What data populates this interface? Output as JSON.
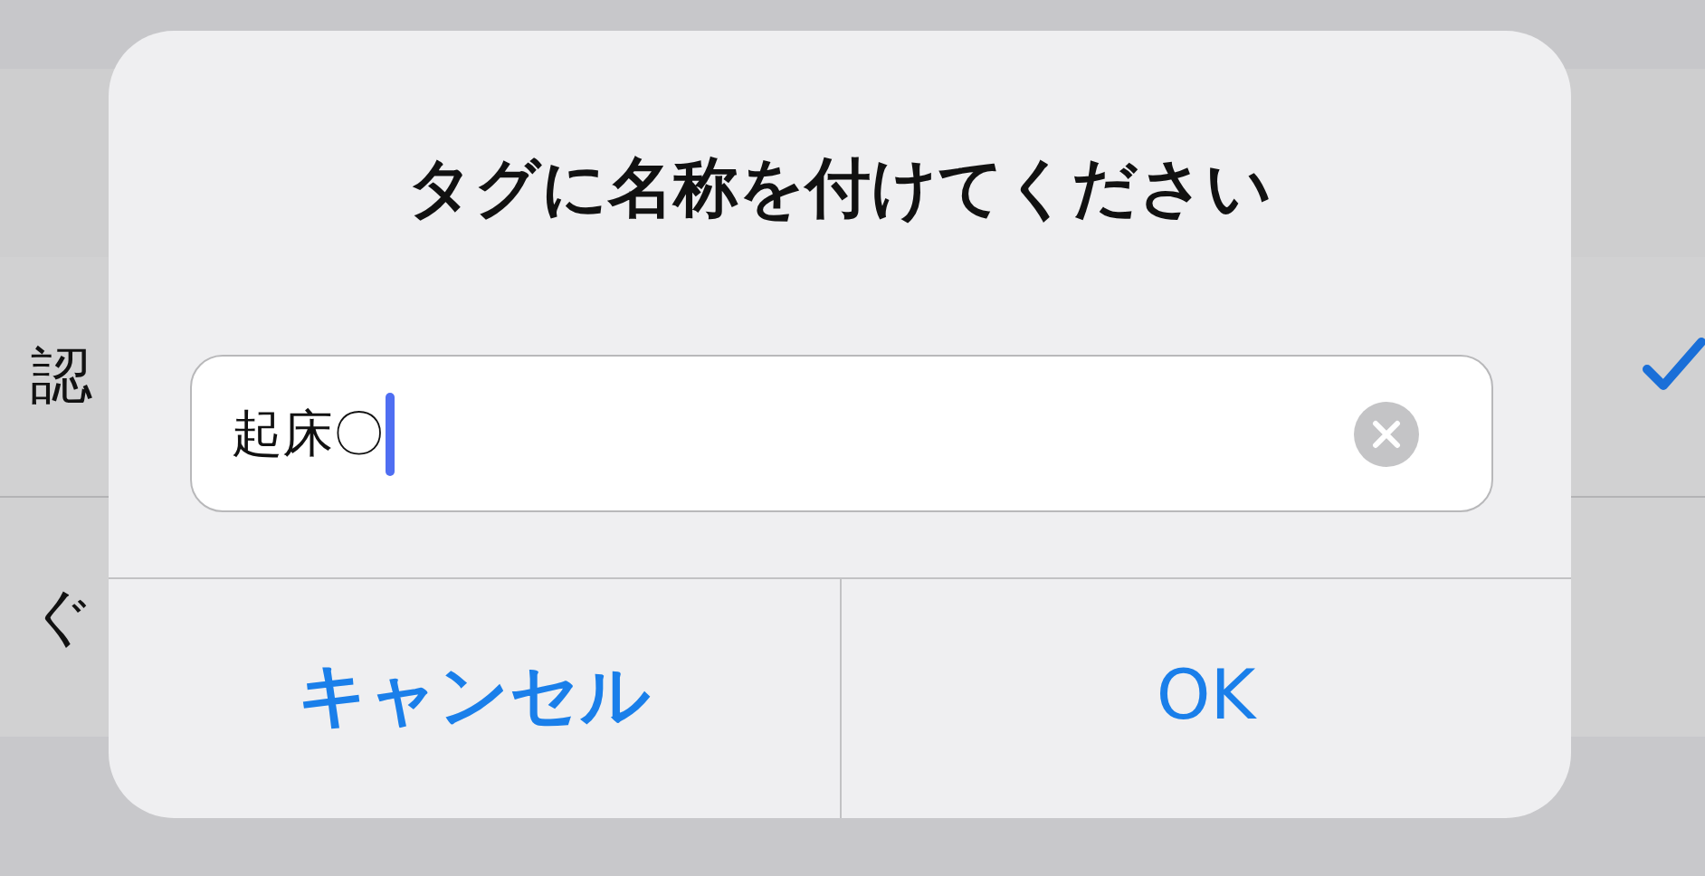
{
  "background_list": {
    "rows": [
      {
        "label": "認",
        "checked": true
      },
      {
        "label": "ぐ",
        "checked": false
      }
    ]
  },
  "dialog": {
    "title": "タグに名称を付けてください",
    "field": {
      "value": "起床〇"
    },
    "buttons": [
      {
        "label": "キャンセル",
        "kind": "cancel"
      },
      {
        "label": "OK",
        "kind": "default"
      }
    ]
  }
}
